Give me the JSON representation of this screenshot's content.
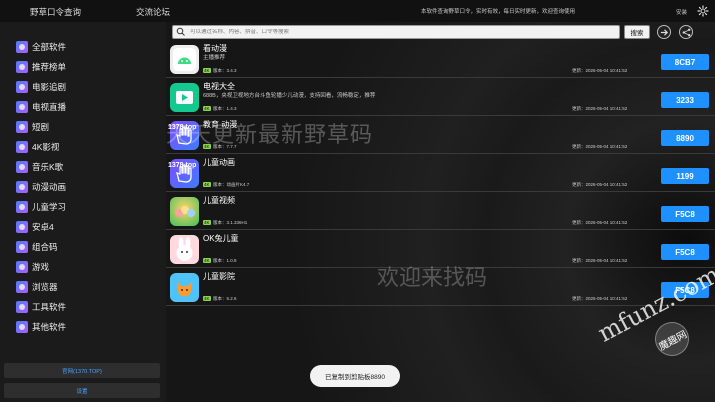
{
  "topbar": {
    "tabs": [
      {
        "label": "野草口令查询"
      },
      {
        "label": "交流论坛"
      }
    ],
    "notice": "本软件查询野草口令，实时有效，每日实时更新，欢迎查询使用",
    "install": "安装",
    "settings_icon": "gear-icon"
  },
  "sidebar": {
    "items": [
      {
        "label": "全部软件"
      },
      {
        "label": "推荐榜单"
      },
      {
        "label": "电影追剧"
      },
      {
        "label": "电视直播"
      },
      {
        "label": "短剧"
      },
      {
        "label": "4K影视"
      },
      {
        "label": "音乐K歌"
      },
      {
        "label": "动漫动画"
      },
      {
        "label": "儿童学习"
      },
      {
        "label": "安卓4"
      },
      {
        "label": "组合码"
      },
      {
        "label": "游戏"
      },
      {
        "label": "浏览器"
      },
      {
        "label": "工具软件"
      },
      {
        "label": "其他软件"
      }
    ],
    "site_button": "官网(1370.TOP)",
    "settings_button": "设置"
  },
  "search": {
    "placeholder": "可以通过名称、内容、拼音、口令等搜索",
    "button": "搜索"
  },
  "apps": [
    {
      "title": "看动漫",
      "desc": "主播推荐",
      "tag": "4K",
      "version": "版本：3.4.3",
      "updated": "更新：2026-05-04 10:41:52",
      "code": "8CB7"
    },
    {
      "title": "电视大全",
      "desc": "688B，央视卫视地方台斗鱼轮播少儿动漫，支持回看，流畅稳定，推荐",
      "tag": "4K",
      "version": "版本：1.4.3",
      "updated": "更新：2026-05-04 10:41:52",
      "code": "3233"
    },
    {
      "title": "教育 动漫",
      "desc": "",
      "tag": "4K",
      "version": "版本：7.7.7",
      "updated": "更新：2026-05-04 10:41:52",
      "code": "8890"
    },
    {
      "title": "儿童动画",
      "desc": "",
      "tag": "4K",
      "version": "版本：动画片K4.7",
      "updated": "更新：2026-05-04 10:41:52",
      "code": "1199"
    },
    {
      "title": "儿童视频",
      "desc": "",
      "tag": "4K",
      "version": "版本：3.1.336H1",
      "updated": "更新：2026-05-04 10:41:52",
      "code": "F5C8"
    },
    {
      "title": "OK兔儿童",
      "desc": "",
      "tag": "4K",
      "version": "版本：1.0.8",
      "updated": "更新：2026-05-04 10:41:52",
      "code": "F5C8"
    },
    {
      "title": "儿童影院",
      "desc": "",
      "tag": "4K",
      "version": "版本：5.2.6",
      "updated": "更新：2026-05-04 10:41:52",
      "code": "F5C8"
    }
  ],
  "icon_labels": {
    "edu": "1378.top",
    "kids": "1378.top"
  },
  "watermarks": {
    "line1": "天天更新最新野草码",
    "line2": "欢迎来找码",
    "site": "mfunz.com",
    "logo": "魔趣网"
  },
  "toast": "已复制到剪贴板8890",
  "colors": {
    "accent": "#1e90ff",
    "tag_green": "#8bd34a"
  }
}
